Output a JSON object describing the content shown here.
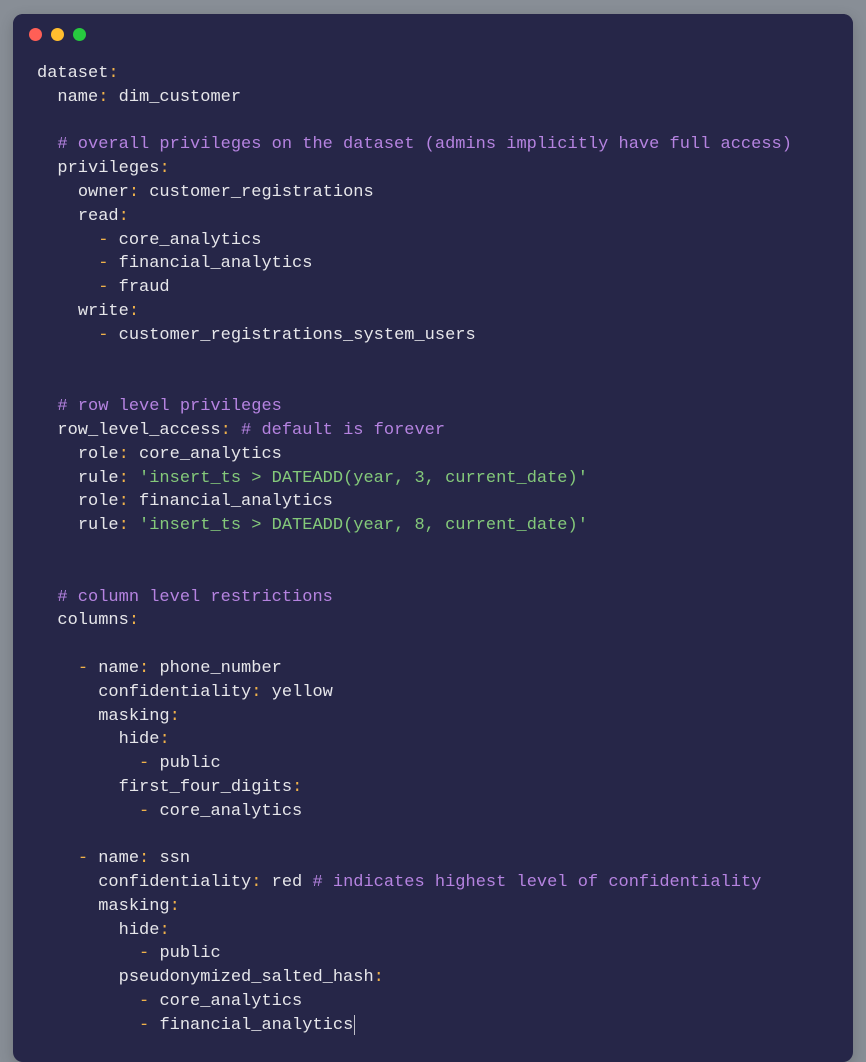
{
  "yaml": {
    "dataset_key": "dataset",
    "name_key": "name",
    "name_value": "dim_customer",
    "comment_overall": "# overall privileges on the dataset (admins implicitly have full access)",
    "privileges_key": "privileges",
    "owner_key": "owner",
    "owner_value": "customer_registrations",
    "read_key": "read",
    "read_items": [
      "core_analytics",
      "financial_analytics",
      "fraud"
    ],
    "write_key": "write",
    "write_items": [
      "customer_registrations_system_users"
    ],
    "comment_row": "# row level privileges",
    "row_access_key": "row_level_access",
    "row_access_inline_comment": "# default is forever",
    "rla_role_key": "role",
    "rla_rule_key": "rule",
    "rla_role1": "core_analytics",
    "rla_rule1": "'insert_ts > DATEADD(year, 3, current_date)'",
    "rla_role2": "financial_analytics",
    "rla_rule2": "'insert_ts > DATEADD(year, 8, current_date)'",
    "comment_col": "# column level restrictions",
    "columns_key": "columns",
    "col_name_key": "name",
    "col_conf_key": "confidentiality",
    "col_mask_key": "masking",
    "hide_key": "hide",
    "c1_name": "phone_number",
    "c1_conf": "yellow",
    "c1_hide_items": [
      "public"
    ],
    "c1_mask2_key": "first_four_digits",
    "c1_mask2_items": [
      "core_analytics"
    ],
    "c2_name": "ssn",
    "c2_conf": "red",
    "c2_conf_comment": "# indicates highest level of confidentiality",
    "c2_hide_items": [
      "public"
    ],
    "c2_mask2_key": "pseudonymized_salted_hash",
    "c2_mask2_items": [
      "core_analytics",
      "financial_analytics"
    ]
  }
}
